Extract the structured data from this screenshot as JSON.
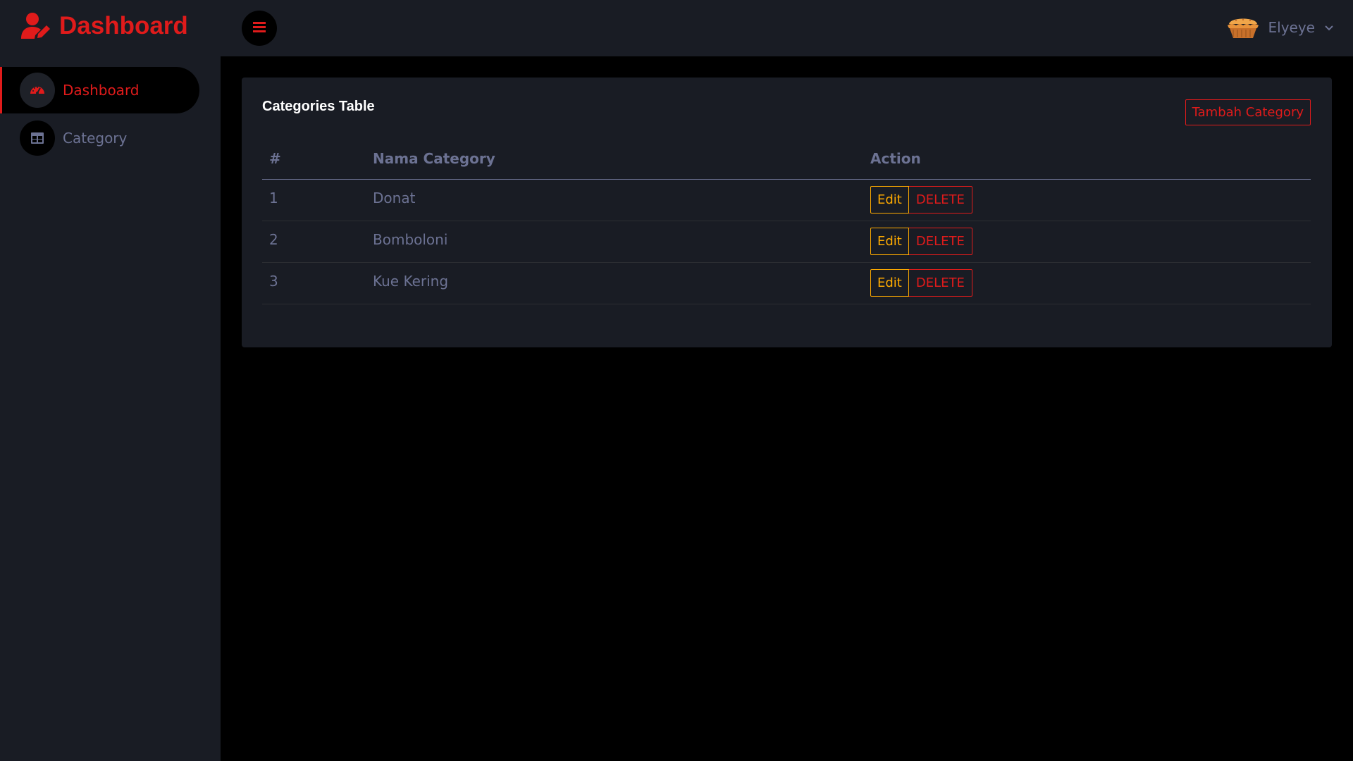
{
  "brand": {
    "title": "Dashboard",
    "icon": "user-edit-icon",
    "color": "#e01b1b"
  },
  "sidebar": {
    "items": [
      {
        "label": "Dashboard",
        "icon": "speedometer-icon",
        "active": true
      },
      {
        "label": "Category",
        "icon": "table-icon",
        "active": false
      }
    ]
  },
  "topbar": {
    "menu_icon": "hamburger-menu-icon",
    "user": {
      "name": "Elyeye",
      "avatar_icon": "pie-avatar-icon",
      "dropdown_icon": "chevron-down-icon"
    }
  },
  "card": {
    "title": "Categories Table",
    "add_button": "Tambah Category",
    "table": {
      "headers": [
        "#",
        "Nama Category",
        "Action"
      ],
      "rows": [
        {
          "no": "1",
          "name": "Donat",
          "edit": "Edit",
          "delete": "DELETE"
        },
        {
          "no": "2",
          "name": "Bomboloni",
          "edit": "Edit",
          "delete": "DELETE"
        },
        {
          "no": "3",
          "name": "Kue Kering",
          "edit": "Edit",
          "delete": "DELETE"
        }
      ]
    }
  },
  "colors": {
    "accent": "#e01b1b",
    "warning": "#ffab00",
    "panel": "#191c24",
    "muted_text": "#6c7293",
    "background": "#000000"
  }
}
